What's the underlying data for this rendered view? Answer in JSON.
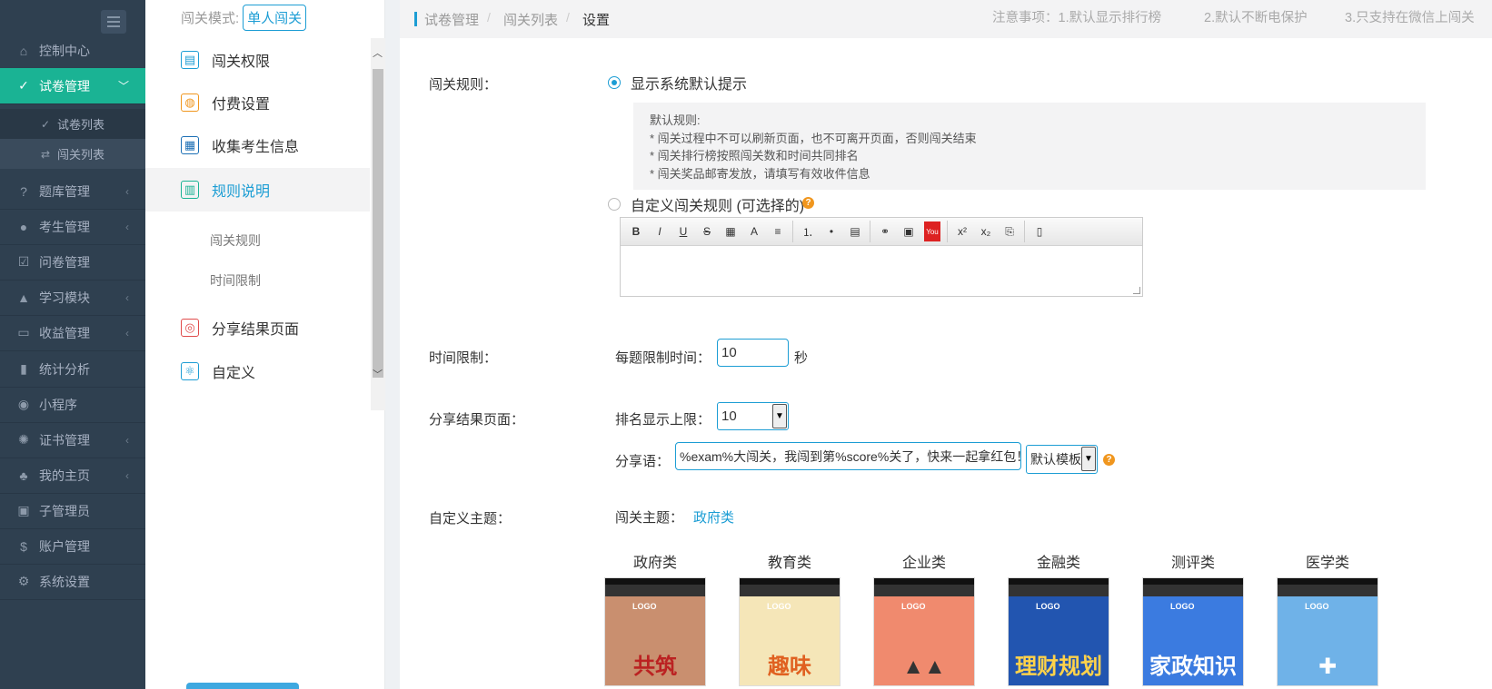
{
  "sidebar": {
    "items": [
      {
        "label": "控制中心",
        "icon": "home-icon",
        "arrow": ""
      },
      {
        "label": "试卷管理",
        "icon": "check-circle-icon",
        "arrow": "﹀"
      },
      {
        "label": "题库管理",
        "icon": "question-circle-icon",
        "arrow": "‹"
      },
      {
        "label": "考生管理",
        "icon": "user-icon",
        "arrow": "‹"
      },
      {
        "label": "问卷管理",
        "icon": "checkbox-icon",
        "arrow": ""
      },
      {
        "label": "学习模块",
        "icon": "graduation-cap-icon",
        "arrow": "‹"
      },
      {
        "label": "收益管理",
        "icon": "money-icon",
        "arrow": "‹"
      },
      {
        "label": "统计分析",
        "icon": "bar-chart-icon",
        "arrow": ""
      },
      {
        "label": "小程序",
        "icon": "wechat-icon",
        "arrow": ""
      },
      {
        "label": "证书管理",
        "icon": "certificate-icon",
        "arrow": "‹"
      },
      {
        "label": "我的主页",
        "icon": "tree-icon",
        "arrow": "‹"
      },
      {
        "label": "子管理员",
        "icon": "lock-icon",
        "arrow": ""
      },
      {
        "label": "账户管理",
        "icon": "dollar-icon",
        "arrow": ""
      },
      {
        "label": "系统设置",
        "icon": "gear-icon",
        "arrow": ""
      }
    ],
    "subitems": [
      {
        "label": "试卷列表",
        "icon": "check-circle-icon"
      },
      {
        "label": "闯关列表",
        "icon": "shuffle-icon"
      }
    ]
  },
  "menu2": {
    "mode_label": "闯关模式:",
    "mode_value": "单人闯关",
    "items": [
      {
        "label": "闯关权限",
        "icon": "lock-doc-icon"
      },
      {
        "label": "付费设置",
        "icon": "money-bag-icon"
      },
      {
        "label": "收集考生信息",
        "icon": "id-card-icon"
      },
      {
        "label": "规则说明",
        "icon": "document-icon"
      },
      {
        "label": "分享结果页面",
        "icon": "share-badge-icon"
      },
      {
        "label": "自定义",
        "icon": "atom-icon"
      }
    ],
    "subitems": [
      "闯关规则",
      "时间限制"
    ]
  },
  "breadcrumb": [
    "试卷管理",
    "闯关列表",
    "设置"
  ],
  "notices": [
    "注意事项：1.默认显示排行榜",
    "2.默认不断电保护",
    "3.只支持在微信上闯关"
  ],
  "form": {
    "rules": {
      "label": "闯关规则：",
      "option_default": "显示系统默认提示",
      "default_text": [
        "默认规则:",
        "* 闯关过程中不可以刷新页面，也不可离开页面，否则闯关结束",
        "* 闯关排行榜按照闯关数和时间共同排名",
        "* 闯关奖品邮寄发放，请填写有效收件信息"
      ],
      "option_custom": "自定义闯关规则 (可选择的)",
      "toolbar": [
        "B",
        "I",
        "U",
        "S",
        "▦",
        "A",
        "≡",
        "|",
        "⒈",
        "•",
        "▤",
        "|",
        "⚭",
        "▣",
        "You",
        "|",
        "x²",
        "x₂",
        "⎘",
        "|",
        "▯"
      ]
    },
    "time": {
      "label": "时间限制：",
      "prefix": "每题限制时间：",
      "value": "10",
      "unit": "秒"
    },
    "share": {
      "label": "分享结果页面：",
      "rank_label": "排名显示上限：",
      "rank_value": "10",
      "phrase_label": "分享语：",
      "phrase_value": "%exam%大闯关，我闯到第%score%关了，快来一起拿红包！",
      "template_value": "默认模板"
    },
    "theme": {
      "label": "自定义主题：",
      "prefix": "闯关主题：",
      "value": "政府类",
      "cards": [
        "政府类",
        "教育类",
        "企业类",
        "金融类",
        "测评类",
        "医学类"
      ]
    }
  },
  "colors": {
    "nav_bg": "#2f4050",
    "nav_active": "#1ab394",
    "accent": "#1c9dd4",
    "help": "#f0961e"
  }
}
